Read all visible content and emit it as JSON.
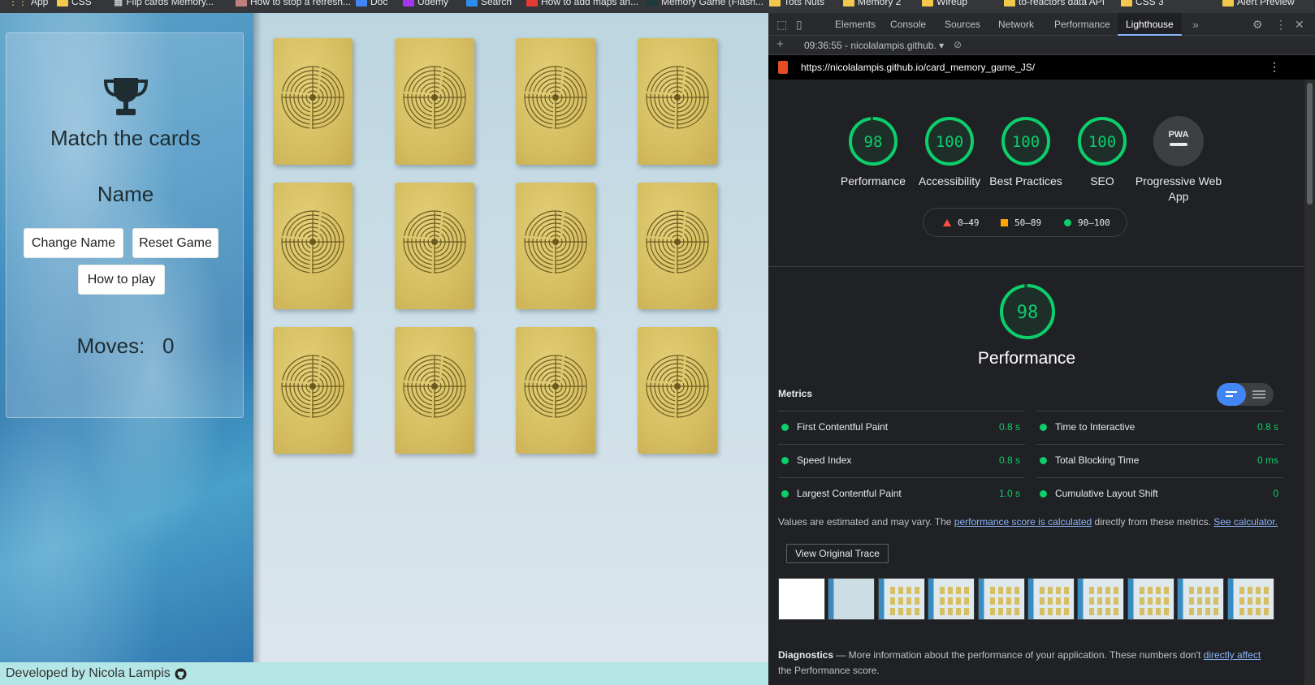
{
  "bookmarks": {
    "items": [
      "App",
      "CSS",
      "Flip cards Memory...",
      "How to stop a refresh...",
      "Doc",
      "Udemy",
      "Search",
      "How to add maps an...",
      "Memory Game (Flash...",
      "Tots Nuts",
      "Memory 2",
      "Wireup",
      "to-reactors data API",
      "CSS 3",
      "Alert Preview"
    ]
  },
  "game": {
    "title": "Match the cards",
    "player_name": "Name",
    "change_name_label": "Change Name",
    "reset_label": "Reset Game",
    "how_to_play_label": "How to play",
    "moves_label": "Moves:",
    "moves_value": "0",
    "cards_count_label": "12 cards",
    "footer_text": "Developed by Nicola Lampis",
    "footer_icon": "github-icon"
  },
  "devtools": {
    "tabs": [
      "Elements",
      "Console",
      "Sources",
      "Network",
      "Performance",
      "Lighthouse"
    ],
    "active_tab": "Lighthouse",
    "report_selector": "09:36:55 - nicolalampis.github.",
    "url": "https://nicolalampis.github.io/card_memory_game_JS/",
    "scores": [
      {
        "label": "Performance",
        "value": "98"
      },
      {
        "label": "Accessibility",
        "value": "100"
      },
      {
        "label": "Best Practices",
        "value": "100"
      },
      {
        "label": "SEO",
        "value": "100"
      },
      {
        "label": "Progressive Web App",
        "value": "PWA"
      }
    ],
    "legend": {
      "red": "0–49",
      "orange": "50–89",
      "green": "90–100"
    },
    "main_score": {
      "value": "98",
      "label": "Performance"
    },
    "metrics_title": "Metrics",
    "metrics": [
      {
        "name": "First Contentful Paint",
        "value": "0.8 s"
      },
      {
        "name": "Time to Interactive",
        "value": "0.8 s"
      },
      {
        "name": "Speed Index",
        "value": "0.8 s"
      },
      {
        "name": "Total Blocking Time",
        "value": "0 ms"
      },
      {
        "name": "Largest Contentful Paint",
        "value": "1.0 s"
      },
      {
        "name": "Cumulative Layout Shift",
        "value": "0"
      }
    ],
    "note_prefix": "Values are estimated and may vary. The ",
    "note_link1": "performance score is calculated",
    "note_mid": " directly from these metrics. ",
    "note_link2": "See calculator.",
    "view_trace_label": "View Original Trace",
    "diagnostics_title": "Diagnostics",
    "diagnostics_text": " — More information about the performance of your application. These numbers don't ",
    "diagnostics_link": "directly affect",
    "diagnostics_tail": " the Performance score."
  },
  "colors": {
    "pass": "#0cce6b",
    "average": "#ffa400",
    "fail": "#ff4e42",
    "accent": "#8ab4f8"
  }
}
